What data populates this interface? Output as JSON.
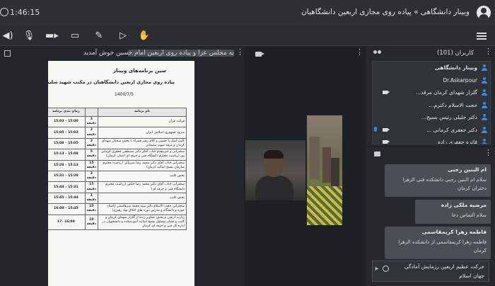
{
  "topbar": {
    "time": "1:46:15",
    "title": "وبینار دانشگاهی » پیاده روی مجازی اربعین دانشگاهیان"
  },
  "toolbar": {
    "icons": [
      "speaker-icon",
      "mic-muted-icon",
      "camera-icon",
      "screen-share-icon",
      "pen-icon",
      "present-icon",
      "raise-hand-icon",
      "menu-icon"
    ]
  },
  "presentation": {
    "header_text": "به مجلس عزا و پیاده روی اربعین امام حسین خوش آمدید",
    "doc": {
      "heading1": "سین برنامه‌های وبینار",
      "heading2": "پیاده روی مجازی اربعین دانشگاهیان در مکتب شهید سلیمانی",
      "date": "1400/7/5",
      "columns": [
        "نام برنامه",
        "زمان بندی برنامه"
      ],
      "rows": [
        {
          "program": "قرائت قرآن",
          "duration": "3 دقیقه",
          "time": "15:03 – 15:00"
        },
        {
          "program": "سرود جمهوری اسلامی ایران",
          "duration": "2 دقیقه",
          "time": "15:05 – 15:03"
        },
        {
          "program": "کلیپ لبیک یا حسین و کلام رهبر همراه با پخش سخنان شهدای کرمان و مرقد شهید سلیمانی",
          "duration": "3 دقیقه",
          "time": "15:08 – 15:05"
        },
        {
          "program": "سخنرانی و خیرمقدم جناب آقای دکتر مصطفی جعفری کرمانی پور (ریاست محترم دانشگاه فنی و حرفه ای استان کرمان)",
          "duration": "5 دقیقه",
          "time": "15:13 – 15:08"
        },
        {
          "program": "سخنرانی جناب آقای دکتر محمد رضا میرزائی (ریاست محترم سازمان بسیج اساتید کرمان)",
          "duration": "15 دقیقه",
          "time": "15:28 – 15:13"
        },
        {
          "program": "پخش کلیپ",
          "duration": "3 دقیقه",
          "time": "15:31 – 15:28"
        },
        {
          "program": "سخنرانی جناب آقای دکتر محمد رضا جلیلی (ریاست محترم دانشگاه فنی و حرفه ای)",
          "duration": "15 دقیقه",
          "time": "15:44 – 15:31"
        },
        {
          "program": "پخش کلیپ",
          "duration": "1 دقیقه",
          "time": "15:45 – 15:44"
        },
        {
          "program": "سخنرانی حجت الاسلام دکتر سید محمد میرهاشمی (استاد حوزه و دانشگاه و مدرس دوره های اخلاق نهاد رهبری)",
          "duration": "15 دقیقه",
          "time": "16:00 – 15:45"
        },
        {
          "program": "زیارت اربعین و پخش تصاویر زنده از گلزار شهدای کرمان و کلیپ و تشکر مسئول بسیج اساتید آموزشکده و دانشجویان در اداره کل فنی و حرفه ای کرمان",
          "duration": "10 دقیقه",
          "time": "17– 16:00"
        }
      ]
    }
  },
  "users": {
    "header": "کاربران (101)",
    "list": [
      {
        "name": "وبینار دانشگاهی",
        "bold": true,
        "cam": false,
        "mic": false
      },
      {
        "name": "Dr.Askarpour",
        "bold": false,
        "cam": false,
        "mic": false
      },
      {
        "name": "گلزار شهدای کرمان مرقد...",
        "bold": false,
        "cam": true,
        "mic": false
      },
      {
        "name": "حجت الاسلام دکترم...",
        "bold": false,
        "cam": false,
        "mic": false
      },
      {
        "name": "دکتر جلیلی رئیس بسیج...",
        "bold": false,
        "cam": false,
        "mic": false
      },
      {
        "name": "دکتر جعفری کرمانی ...",
        "bold": false,
        "cam": true,
        "mic": true
      },
      {
        "name": "فائزه جعفری زاده",
        "bold": false,
        "cam": true,
        "mic": false
      }
    ]
  },
  "chat": {
    "messages": [
      {
        "who": "ام البنین رجبی",
        "text1": "سلام ام البنین رجبی دانشکده فنی الزهرا",
        "text2": "دختران کرمان"
      },
      {
        "who": "مرضیه ملکی زاده",
        "text1": "سلام التماس دعا",
        "text2": ""
      },
      {
        "who": "فاطمه زهرا کریمقاسمی",
        "text1": "فاطمه زهرا کریمقاسمی از دانشکده الزهرا",
        "text2": "کرمان"
      }
    ],
    "input_line1": "حرکت عظیم اربعین رزمایش آمادگی",
    "input_line2": "جهان اسلام"
  },
  "colors": {
    "accent": "#2e8de6",
    "bg": "#1f2226",
    "panel": "#25292d"
  }
}
